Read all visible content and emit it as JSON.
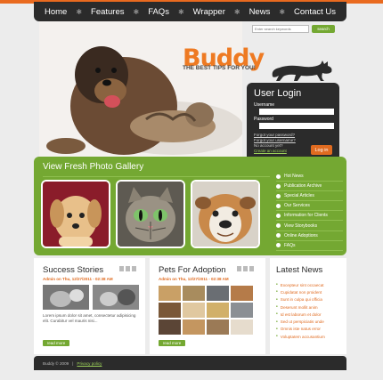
{
  "nav": {
    "items": [
      "Home",
      "Features",
      "FAQs",
      "Wrapper",
      "News",
      "Contact Us"
    ]
  },
  "search": {
    "placeholder": "Enter search keywords",
    "button": "search"
  },
  "brand": {
    "logo": "Buddy",
    "tagline": "THE BEST TIPS FOR YOU!"
  },
  "login": {
    "title": "User Login",
    "username_label": "Username",
    "password_label": "Password",
    "forgot_password": "Forgot your password?",
    "forgot_username": "Forgot your username?",
    "no_account": "No account yet?",
    "create_account": "Create an account",
    "button": "Log in"
  },
  "gallery": {
    "title": "View Fresh Photo Gallery",
    "links": [
      "Hot News",
      "Publication Archive",
      "Special Articles",
      "Our Services",
      "Information for Clients",
      "View Storybooks",
      "Online Adoptions",
      "FAQs"
    ]
  },
  "success": {
    "title": "Success Stories",
    "meta": "Admin on Thu, 12/27/2011 - 02:38 AM",
    "text": "Lorem ipsum dolor sit amet, consectetur adipisicing elit. Curabitur vel mauris nisi...",
    "more": "read more"
  },
  "adoption": {
    "title": "Pets For Adoption",
    "meta": "Admin on Thu, 12/27/2011 - 02:38 AM",
    "more": "read more"
  },
  "news": {
    "title": "Latest News",
    "items": [
      "Excepteur sint occaecat",
      "Cupidatat non proident",
      "Sunt in culpa qui officia",
      "Deserunt mollit anim",
      "Id est laborum et dolor",
      "Sed ut perspiciatis unde",
      "Omnis iste natus error",
      "Voluptatem accusantium"
    ]
  },
  "footer": {
    "copyright": "Buddy © 2009",
    "sep": "|",
    "privacy": "Privacy policy"
  },
  "colors": {
    "accent_green": "#74a832",
    "accent_orange": "#e96a1f",
    "dark": "#2b2b2b"
  }
}
